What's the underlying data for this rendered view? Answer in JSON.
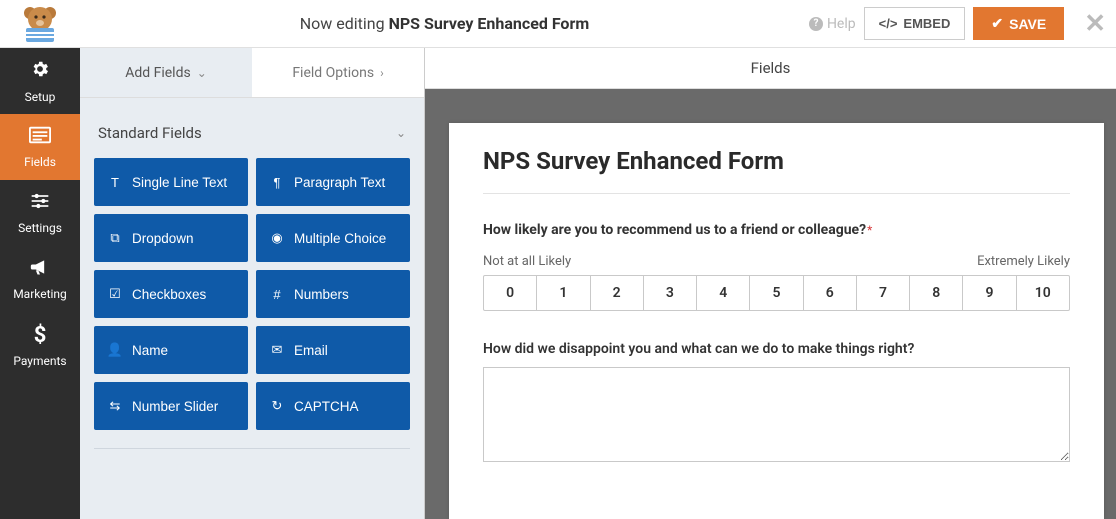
{
  "topbar": {
    "title_prefix": "Now editing",
    "title_name": "NPS Survey Enhanced Form",
    "help_label": "Help",
    "embed_label": "EMBED",
    "save_label": "SAVE"
  },
  "leftnav": [
    {
      "key": "setup",
      "label": "Setup",
      "icon": "⚙"
    },
    {
      "key": "fields",
      "label": "Fields",
      "icon": "≡"
    },
    {
      "key": "settings",
      "label": "Settings",
      "icon": "⚙"
    },
    {
      "key": "marketing",
      "label": "Marketing",
      "icon": "📣"
    },
    {
      "key": "payments",
      "label": "Payments",
      "icon": "$"
    }
  ],
  "panel": {
    "tabs": {
      "add": "Add Fields",
      "options": "Field Options"
    },
    "section_title": "Standard Fields",
    "fields": [
      {
        "label": "Single Line Text",
        "icon": "T"
      },
      {
        "label": "Paragraph Text",
        "icon": "¶"
      },
      {
        "label": "Dropdown",
        "icon": "⧉"
      },
      {
        "label": "Multiple Choice",
        "icon": "◉"
      },
      {
        "label": "Checkboxes",
        "icon": "☑"
      },
      {
        "label": "Numbers",
        "icon": "#"
      },
      {
        "label": "Name",
        "icon": "👤"
      },
      {
        "label": "Email",
        "icon": "✉"
      },
      {
        "label": "Number Slider",
        "icon": "⇆"
      },
      {
        "label": "CAPTCHA",
        "icon": "↻"
      }
    ]
  },
  "canvas": {
    "header": "Fields",
    "form_title": "NPS Survey Enhanced Form",
    "q1_label": "How likely are you to recommend us to a friend or colleague?",
    "q1_required": true,
    "scale_low": "Not at all Likely",
    "scale_high": "Extremely Likely",
    "nps_values": [
      "0",
      "1",
      "2",
      "3",
      "4",
      "5",
      "6",
      "7",
      "8",
      "9",
      "10"
    ],
    "q2_label": "How did we disappoint you and what can we do to make things right?",
    "q2_value": ""
  }
}
